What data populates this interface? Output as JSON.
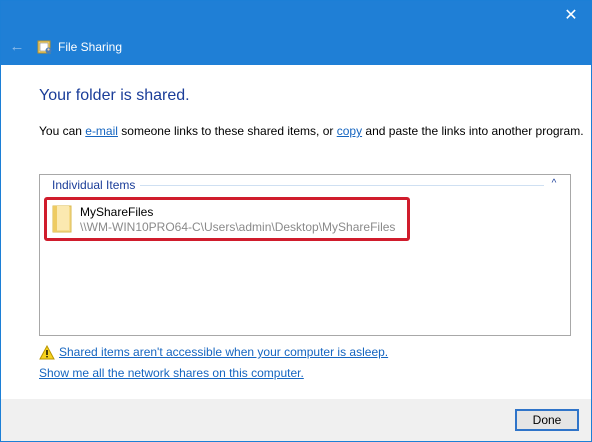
{
  "window": {
    "title": "File Sharing",
    "back_glyph": "←",
    "close_glyph": "✕",
    "app_icon": "file-sharing-icon"
  },
  "main": {
    "heading": "Your folder is shared.",
    "description": {
      "prefix": "You can ",
      "email_link": "e-mail",
      "middle": " someone links to these shared items, or ",
      "copy_link": "copy",
      "suffix": " and paste the links into another program."
    }
  },
  "items": {
    "group_label": "Individual Items",
    "collapse_glyph": "^",
    "list": [
      {
        "name": "MyShareFiles",
        "path": "\\\\WM-WIN10PRO64-C\\Users\\admin\\Desktop\\MyShareFiles",
        "icon": "folder-icon"
      }
    ],
    "highlight_color": "#d01c2c"
  },
  "warning": {
    "icon": "warning-icon",
    "text": "Shared items aren't accessible when your computer is asleep."
  },
  "network_shares_link": "Show me all the network shares on this computer.",
  "footer": {
    "done_label": "Done"
  },
  "colors": {
    "titlebar": "#1f7fd6",
    "heading": "#1a3d99",
    "link": "#1565c0"
  }
}
